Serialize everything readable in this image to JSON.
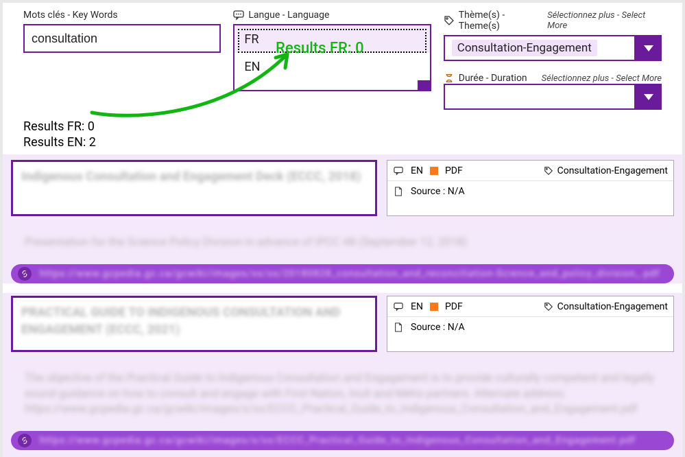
{
  "filters": {
    "keywords": {
      "label": "Mots clés - Key Words",
      "value": "consultation"
    },
    "language": {
      "label": "Langue - Language",
      "options": [
        "FR",
        "EN"
      ],
      "selected": "FR"
    },
    "themes": {
      "label": "Thème(s) - Theme(s)",
      "select_more": "Sélectionnez plus - Select More",
      "value": "Consultation-Engagement"
    },
    "duration": {
      "label": "Durée - Duration",
      "select_more": "Sélectionnez plus - Select More",
      "value": ""
    }
  },
  "annotation": {
    "text": "Results FR: 0"
  },
  "counts": {
    "fr": "Results FR: 0",
    "en": "Results EN: 2"
  },
  "results": [
    {
      "title_blur": "Indigenous Consultation and\nEngagement Deck (ECCC, 2018)",
      "lang": "EN",
      "format": "PDF",
      "theme": "Consultation-Engagement",
      "source": "Source : N/A",
      "body_blur": "Presentation for the Science Policy Division in advance of IPCC 48 (September 12, 2018)",
      "link_blur": "https://www.gcpedia.gc.ca/gcwiki/images/xx/xx/20180828_consultation_and_reconciliation-Science_and_policy_division_.pdf"
    },
    {
      "title_blur": "PRACTICAL GUIDE TO INDIGENOUS CONSULTATION AND\nENGAGEMENT (ECCC, 2021)",
      "lang": "EN",
      "format": "PDF",
      "theme": "Consultation-Engagement",
      "source": "Source : N/A",
      "body_blur": "The objective of the Practical Guide to Indigenous Consultation and Engagement is to provide culturally competent and legally sound guidance on how to consult and engage with First Nation, Inuit and Métis partners. Alternate address: https://www.gcpedia.gc.ca/gcwiki/images/x/xx/ECCC_Practical_Guide_to_Indigenous_Consultation_and_Engagement.pdf",
      "link_blur": "https://www.gcpedia.gc.ca/gcwiki/images/x/xx/ECCC_Practical_Guide_to_Indigenous_Consultation_and_Engagement.pdf"
    }
  ],
  "icons": {
    "chat": "chat-icon",
    "tag": "tag-icon",
    "hourglass": "hourglass-icon",
    "page": "page-icon",
    "link": "link-icon"
  }
}
